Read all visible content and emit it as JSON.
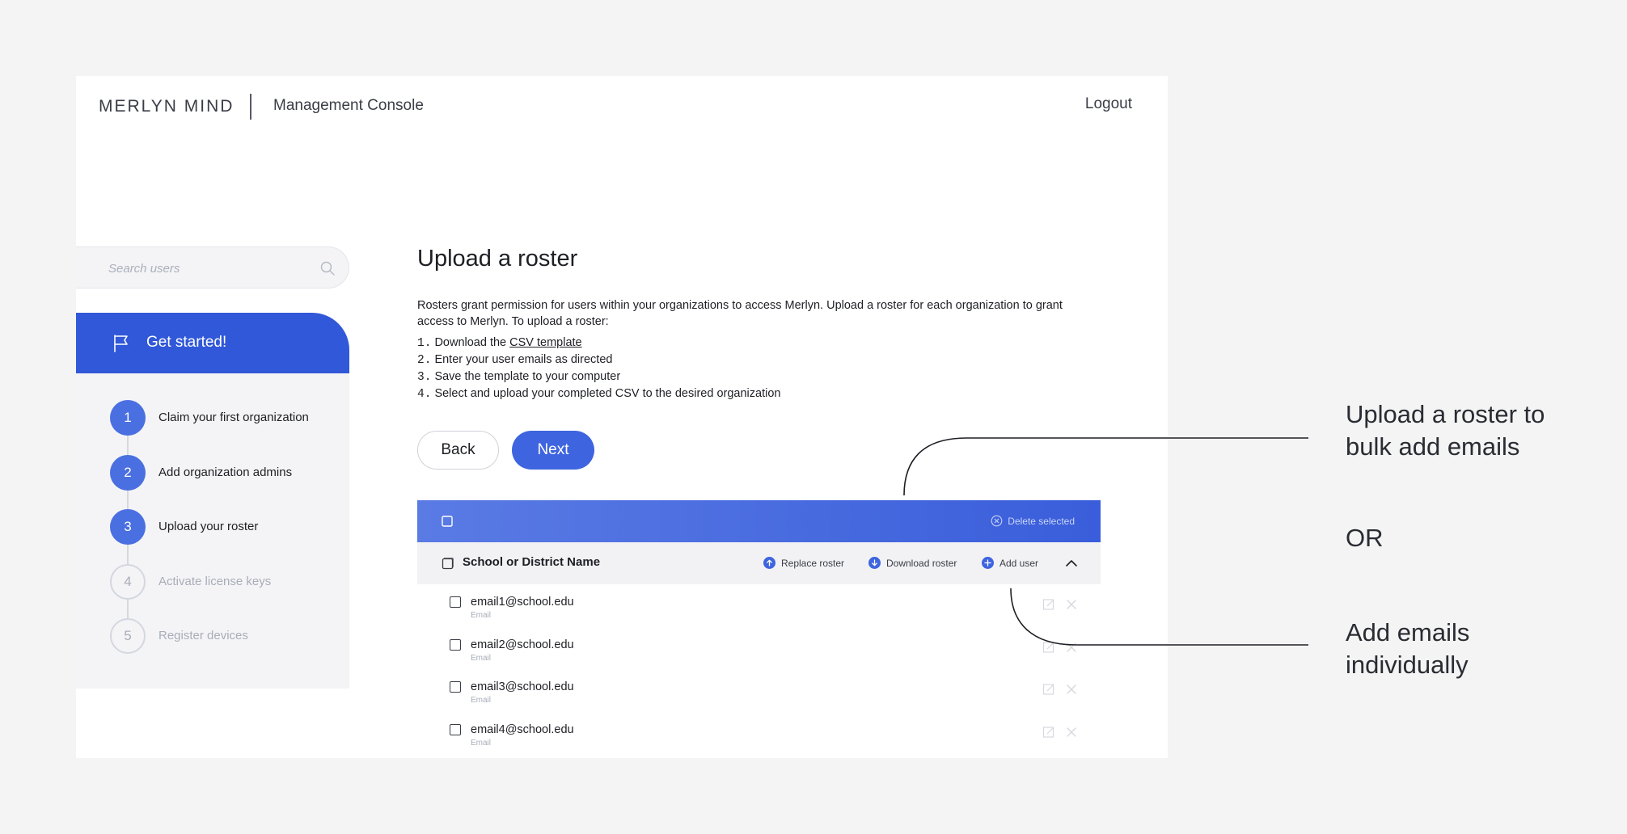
{
  "header": {
    "brand": "MERLYN MIND",
    "console_title": "Management Console",
    "logout_label": "Logout"
  },
  "sidebar": {
    "search_placeholder": "Search users",
    "get_started_label": "Get started!",
    "steps": [
      {
        "number": "1",
        "label": "Claim your first organization",
        "state": "complete"
      },
      {
        "number": "2",
        "label": "Add organization admins",
        "state": "complete"
      },
      {
        "number": "3",
        "label": "Upload your roster",
        "state": "current"
      },
      {
        "number": "4",
        "label": "Activate license keys",
        "state": "upcoming"
      },
      {
        "number": "5",
        "label": "Register devices",
        "state": "upcoming"
      }
    ]
  },
  "main": {
    "title": "Upload a roster",
    "description": "Rosters grant permission for users within your organizations to access Merlyn. Upload a roster for each organization to grant access to Merlyn. To upload a roster:",
    "instructions": [
      {
        "number": "1.",
        "text": "Download the ",
        "link": "CSV template"
      },
      {
        "number": "2.",
        "text": "Enter your user emails as directed"
      },
      {
        "number": "3.",
        "text": "Save the template to your computer"
      },
      {
        "number": "4.",
        "text": "Select and upload your completed CSV to the desired organization"
      }
    ],
    "back_label": "Back",
    "next_label": "Next"
  },
  "table": {
    "delete_selected_label": "Delete selected",
    "org_name": "School or District Name",
    "actions": {
      "replace": "Replace roster",
      "download": "Download roster",
      "add_user": "Add user"
    },
    "rows": [
      {
        "email": "email1@school.edu",
        "type": "Email"
      },
      {
        "email": "email2@school.edu",
        "type": "Email"
      },
      {
        "email": "email3@school.edu",
        "type": "Email"
      },
      {
        "email": "email4@school.edu",
        "type": "Email"
      }
    ]
  },
  "annotations": {
    "roster_line1": "Upload a roster to",
    "roster_line2": "bulk add emails",
    "or": "OR",
    "individual_line1": "Add emails",
    "individual_line2": "individually"
  },
  "colors": {
    "accent": "#3158d8",
    "button": "#3e64df",
    "sidebar_bg": "#f4f4f6"
  }
}
